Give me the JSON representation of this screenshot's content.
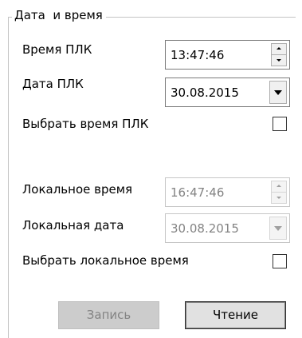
{
  "group": {
    "title": "Дата  и время"
  },
  "plc": {
    "time_label": "Время ПЛК",
    "time_value": "13:47:46",
    "date_label": "Дата ПЛК",
    "date_value": "30.08.2015",
    "select_label": "Выбрать время ПЛК",
    "select_checked": false
  },
  "local": {
    "time_label": "Локальное время",
    "time_value": "16:47:46",
    "date_label": "Локальная дата",
    "date_value": "30.08.2015",
    "select_label": "Выбрать локальное время",
    "select_checked": false,
    "controls_enabled": false
  },
  "buttons": {
    "write_label": "Запись",
    "write_enabled": false,
    "read_label": "Чтение",
    "read_enabled": true
  },
  "icons": {
    "spin_up": "spin-up-arrow-icon",
    "spin_down": "spin-down-arrow-icon",
    "dropdown": "chevron-down-icon"
  }
}
